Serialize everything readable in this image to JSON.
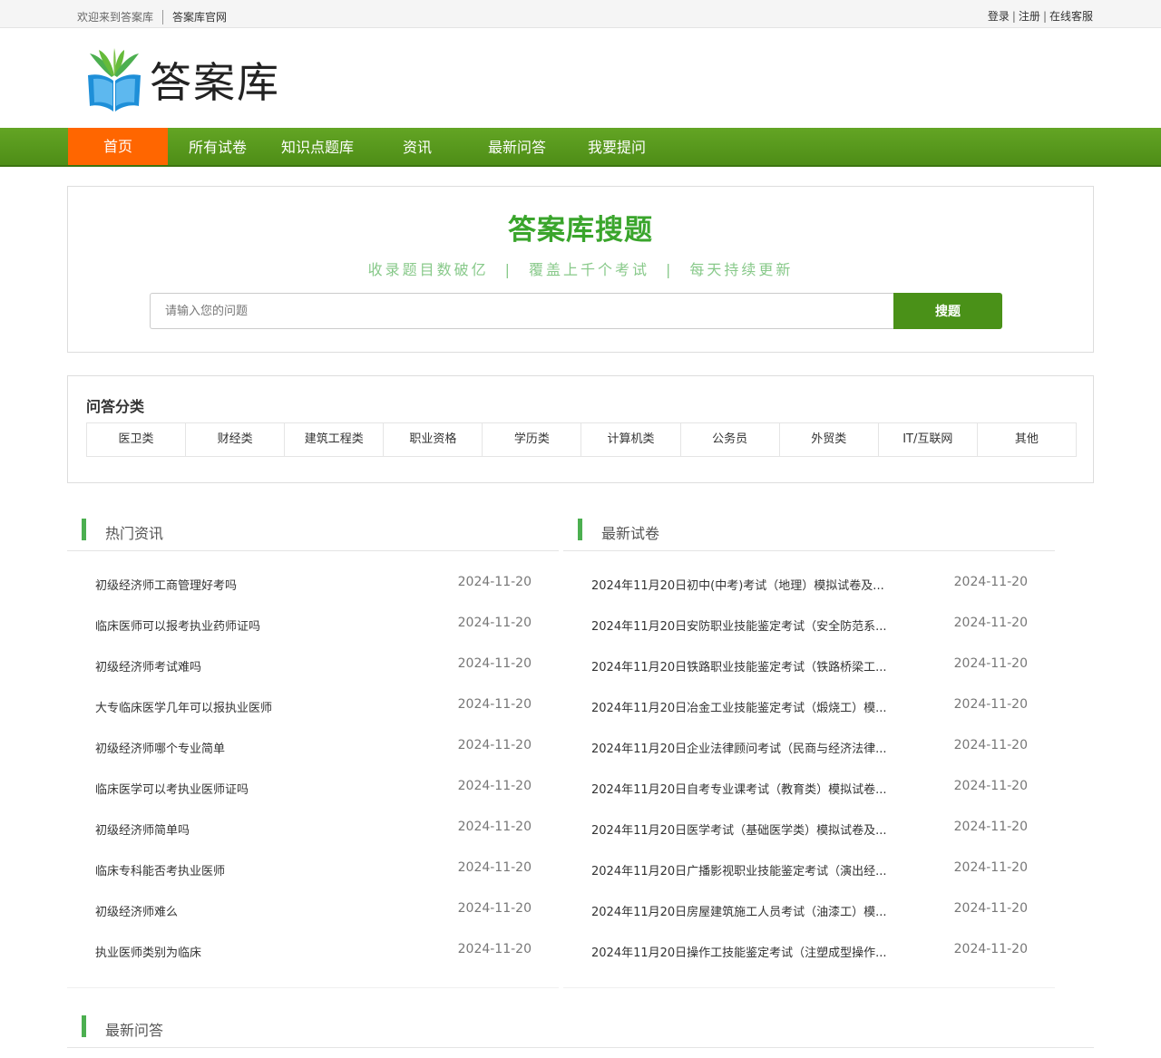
{
  "topbar": {
    "welcome": "欢迎来到答案库",
    "site_link": "答案库官网",
    "login": "登录",
    "register": "注册",
    "support": "在线客服",
    "pipe": "|"
  },
  "logo": {
    "text": "答案库"
  },
  "nav": {
    "items": [
      "首页",
      "所有试卷",
      "知识点题库",
      "资讯",
      "最新问答",
      "我要提问"
    ],
    "active_index": 0
  },
  "search": {
    "title": "答案库搜题",
    "sub1": "收录题目数破亿",
    "sub2": "覆盖上千个考试",
    "sub3": "每天持续更新",
    "sep": "|",
    "placeholder": "请输入您的问题",
    "button": "搜题"
  },
  "categories": {
    "title": "问答分类",
    "items": [
      "医卫类",
      "财经类",
      "建筑工程类",
      "职业资格",
      "学历类",
      "计算机类",
      "公务员",
      "外贸类",
      "IT/互联网",
      "其他"
    ]
  },
  "hot_news": {
    "title": "热门资讯",
    "rows": [
      {
        "title": "初级经济师工商管理好考吗",
        "date": "2024-11-20"
      },
      {
        "title": "临床医师可以报考执业药师证吗",
        "date": "2024-11-20"
      },
      {
        "title": "初级经济师考试难吗",
        "date": "2024-11-20"
      },
      {
        "title": "大专临床医学几年可以报执业医师",
        "date": "2024-11-20"
      },
      {
        "title": "初级经济师哪个专业简单",
        "date": "2024-11-20"
      },
      {
        "title": "临床医学可以考执业医师证吗",
        "date": "2024-11-20"
      },
      {
        "title": "初级经济师简单吗",
        "date": "2024-11-20"
      },
      {
        "title": "临床专科能否考执业医师",
        "date": "2024-11-20"
      },
      {
        "title": "初级经济师难么",
        "date": "2024-11-20"
      },
      {
        "title": "执业医师类别为临床",
        "date": "2024-11-20"
      }
    ]
  },
  "latest_papers": {
    "title": "最新试卷",
    "rows": [
      {
        "title": "2024年11月20日初中(中考)考试（地理）模拟试卷及...",
        "date": "2024-11-20"
      },
      {
        "title": "2024年11月20日安防职业技能鉴定考试（安全防范系...",
        "date": "2024-11-20"
      },
      {
        "title": "2024年11月20日铁路职业技能鉴定考试（铁路桥梁工...",
        "date": "2024-11-20"
      },
      {
        "title": "2024年11月20日冶金工业技能鉴定考试（煅烧工）模...",
        "date": "2024-11-20"
      },
      {
        "title": "2024年11月20日企业法律顾问考试（民商与经济法律...",
        "date": "2024-11-20"
      },
      {
        "title": "2024年11月20日自考专业课考试（教育类）模拟试卷...",
        "date": "2024-11-20"
      },
      {
        "title": "2024年11月20日医学考试（基础医学类）模拟试卷及...",
        "date": "2024-11-20"
      },
      {
        "title": "2024年11月20日广播影视职业技能鉴定考试（演出经...",
        "date": "2024-11-20"
      },
      {
        "title": "2024年11月20日房屋建筑施工人员考试（油漆工）模...",
        "date": "2024-11-20"
      },
      {
        "title": "2024年11月20日操作工技能鉴定考试（注塑成型操作...",
        "date": "2024-11-20"
      }
    ]
  },
  "latest_qa": {
    "title": "最新问答"
  }
}
